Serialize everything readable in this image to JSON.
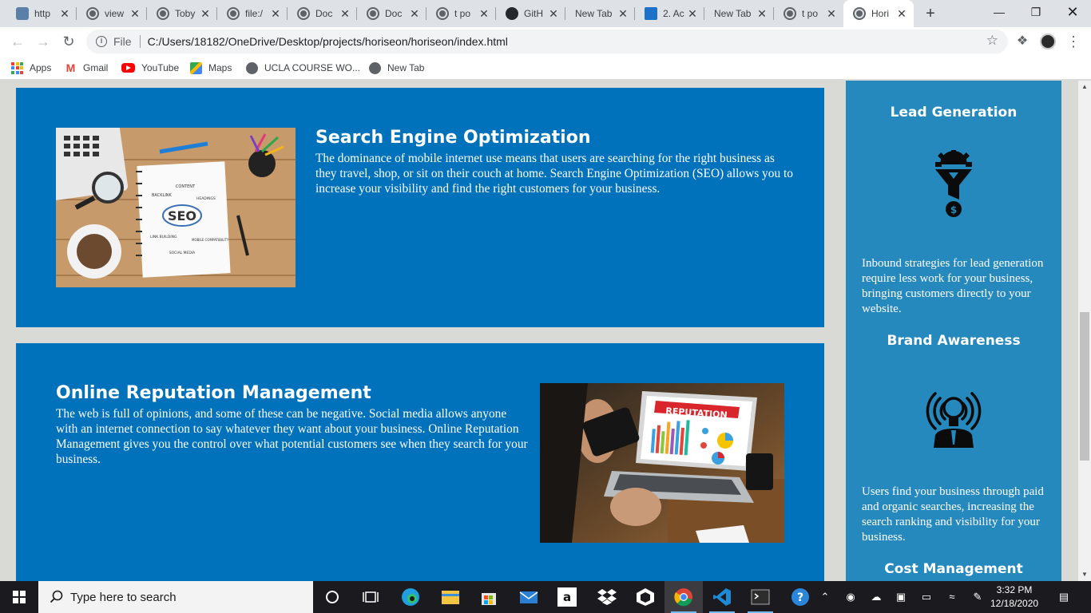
{
  "tabs": [
    {
      "title": "http",
      "icon": "cube-icon"
    },
    {
      "title": "view",
      "icon": "globe-icon"
    },
    {
      "title": "Toby",
      "icon": "globe-icon"
    },
    {
      "title": "file:/",
      "icon": "globe-icon"
    },
    {
      "title": "Doc",
      "icon": "globe-icon"
    },
    {
      "title": "Doc",
      "icon": "globe-icon"
    },
    {
      "title": "t po",
      "icon": "globe-icon"
    },
    {
      "title": "GitH",
      "icon": "github-icon"
    },
    {
      "title": "New Tab",
      "icon": ""
    },
    {
      "title": "2. Ac",
      "icon": "doc-icon"
    },
    {
      "title": "New Tab",
      "icon": ""
    },
    {
      "title": "t po",
      "icon": "globe-icon"
    },
    {
      "title": "Hori",
      "icon": "globe-icon",
      "active": true
    }
  ],
  "toolbar": {
    "scheme": "File",
    "url": "C:/Users/18182/OneDrive/Desktop/projects/horiseon/horiseon/index.html"
  },
  "bookmarks": [
    {
      "label": "Apps",
      "icon": "apps-icon"
    },
    {
      "label": "Gmail",
      "icon": "gmail-icon"
    },
    {
      "label": "YouTube",
      "icon": "youtube-icon"
    },
    {
      "label": "Maps",
      "icon": "maps-icon"
    },
    {
      "label": "UCLA COURSE WO...",
      "icon": "globe-icon"
    },
    {
      "label": "New Tab",
      "icon": "globe-icon"
    }
  ],
  "page": {
    "seo": {
      "title": "Search Engine Optimization",
      "text": "The dominance of mobile internet use means that users are searching for the right business as they travel, shop, or sit on their couch at home. Search Engine Optimization (SEO) allows you to increase your visibility and find the right customers for your business.",
      "image_words": [
        "CONTENT",
        "BACKLINK",
        "HEADINGS",
        "SEO",
        "LINK BUILDING",
        "MOBILE COMPATIBILITY",
        "SOCIAL MEDIA"
      ]
    },
    "orm": {
      "title": "Online Reputation Management",
      "text": "The web is full of opinions, and some of these can be negative. Social media allows anyone with an internet connection to say whatever they want about your business. Online Reputation Management gives you the control over what potential customers see when they search for your business.",
      "image_word": "REPUTATION"
    },
    "sidebar": {
      "lead": {
        "title": "Lead Generation",
        "text": "Inbound strategies for lead generation require less work for your business, bringing customers directly to your website."
      },
      "brand": {
        "title": "Brand Awareness",
        "text": "Users find your business through paid and organic searches, increasing the search ranking and visibility for your business."
      },
      "cost": {
        "title": "Cost Management"
      }
    }
  },
  "taskbar": {
    "search_placeholder": "Type here to search",
    "time": "3:32 PM",
    "date": "12/18/2020"
  }
}
